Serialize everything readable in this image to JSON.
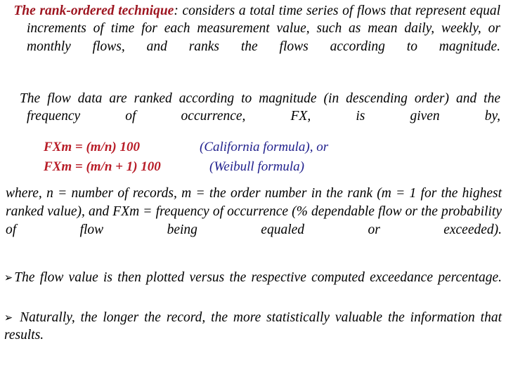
{
  "slide": {
    "background_color": "#ffffff",
    "colors": {
      "heading_red": "#9e1621",
      "formula_red": "#b81c27",
      "formula_blue": "#1f1f8c",
      "body_black": "#000000"
    }
  },
  "bullets": {
    "glyph": "➢",
    "one": {
      "lead_term": "The rank-ordered technique",
      "text": ": considers a total time series of flows that represent equal increments of time for each measurement value, such as mean daily, weekly, or monthly flows, and ranks the flows according to magnitude."
    },
    "two": {
      "text": "The flow data are ranked according to magnitude (in descending order) and the frequency of occurrence, FX, is given by,"
    },
    "three": {
      "text": "The flow value is then plotted versus the respective computed exceedance percentage."
    },
    "four": {
      "text": "Naturally, the longer the record, the more statistically valuable the information that results."
    }
  },
  "formulas": [
    {
      "expression": "FXm = (m/n) 100",
      "label": "(California formula), or"
    },
    {
      "expression": "FXm = (m/n + 1) 100",
      "label": "(Weibull formula)"
    }
  ],
  "where_note": "where, n = number of records, m = the order number in the rank (m = 1 for the highest ranked value), and FXm = frequency of occurrence (% dependable flow or the probability of flow being equaled or exceeded)."
}
